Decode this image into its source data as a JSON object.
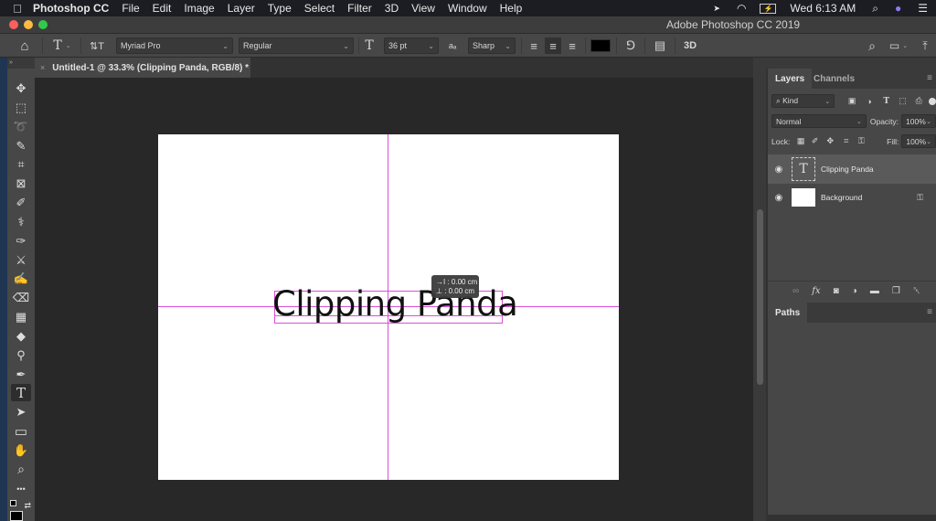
{
  "menubar": {
    "apple": "",
    "app_name": "Photoshop CC",
    "items": [
      "File",
      "Edit",
      "Image",
      "Layer",
      "Type",
      "Select",
      "Filter",
      "3D",
      "View",
      "Window",
      "Help"
    ],
    "status": {
      "location_icon": "➤",
      "wifi_icon": "◠",
      "battery_icon": "⚡",
      "clock": "Wed 6:13 AM",
      "search_icon": "⌕",
      "siri_icon": "●",
      "control_icon": "☰"
    }
  },
  "window": {
    "title": "Adobe Photoshop CC 2019",
    "traffic_colors": [
      "#fc605c",
      "#fdbc40",
      "#34c84a"
    ]
  },
  "options": {
    "home_icon": "⌂",
    "tool_icon": "T",
    "orientation_icon": "⇅T",
    "font_family": "Myriad Pro",
    "font_style": "Regular",
    "size_icon": "T",
    "font_size": "36 pt",
    "aa_icon": "aₐ",
    "antialias": "Sharp",
    "align_left_icon": "≡",
    "align_center_icon": "≡",
    "align_right_icon": "≡",
    "text_color": "#000000",
    "warp_icon": "⅁",
    "panels_icon": "▤",
    "threed_label": "3D",
    "search_icon": "⌕",
    "workspace_icon": "▭",
    "share_icon": "⤒"
  },
  "document": {
    "tab_close": "×",
    "tab_title": "Untitled-1 @ 33.3% (Clipping Panda, RGB/8) *",
    "canvas_text": "Clipping Panda",
    "guide_color": "#d84fd8",
    "tooltip_line1": "→I : 0.00 cm",
    "tooltip_line2": "⊥ : 0.00 cm"
  },
  "tools": [
    {
      "name": "move-tool",
      "icon": "✥"
    },
    {
      "name": "marquee-tool",
      "icon": "⬚"
    },
    {
      "name": "lasso-tool",
      "icon": "➰"
    },
    {
      "name": "quick-selection-tool",
      "icon": "✎"
    },
    {
      "name": "crop-tool",
      "icon": "⌗"
    },
    {
      "name": "frame-tool",
      "icon": "⊠"
    },
    {
      "name": "eyedropper-tool",
      "icon": "✐"
    },
    {
      "name": "healing-brush-tool",
      "icon": "⚕"
    },
    {
      "name": "brush-tool",
      "icon": "✑"
    },
    {
      "name": "clone-stamp-tool",
      "icon": "⚔"
    },
    {
      "name": "history-brush-tool",
      "icon": "✍"
    },
    {
      "name": "eraser-tool",
      "icon": "⌫"
    },
    {
      "name": "gradient-tool",
      "icon": "▦"
    },
    {
      "name": "blur-tool",
      "icon": "◆"
    },
    {
      "name": "dodge-tool",
      "icon": "⚲"
    },
    {
      "name": "pen-tool",
      "icon": "✒"
    },
    {
      "name": "type-tool",
      "icon": "T"
    },
    {
      "name": "path-selection-tool",
      "icon": "➤"
    },
    {
      "name": "rectangle-tool",
      "icon": "▭"
    },
    {
      "name": "hand-tool",
      "icon": "✋"
    },
    {
      "name": "zoom-tool",
      "icon": "⌕"
    },
    {
      "name": "edit-toolbar",
      "icon": "•••"
    },
    {
      "name": "swap-colors",
      "icon": "⇄"
    }
  ],
  "layers_panel": {
    "tabs": [
      "Layers",
      "Channels"
    ],
    "menu_icon": "≡",
    "filter_label": "Kind",
    "filter_icons": [
      "▣",
      "◑",
      "T",
      "⬚",
      "⎙"
    ],
    "blend_mode": "Normal",
    "opacity_label": "Opacity:",
    "opacity": "100%",
    "lock_label": "Lock:",
    "lock_icons": [
      "▦",
      "✐",
      "✥",
      "⌗",
      "⚿"
    ],
    "fill_label": "Fill:",
    "fill": "100%",
    "layers": [
      {
        "name": "Clipping Panda",
        "type": "text",
        "visible_icon": "◉",
        "thumb": "T"
      },
      {
        "name": "Background",
        "type": "pixel",
        "visible_icon": "◉",
        "lock_icon": "⚿"
      }
    ],
    "footer_icons": [
      "∞",
      "fx",
      "◙",
      "◑",
      "▬",
      "❐",
      "␡"
    ]
  },
  "paths_panel": {
    "tab": "Paths",
    "menu_icon": "≡"
  }
}
